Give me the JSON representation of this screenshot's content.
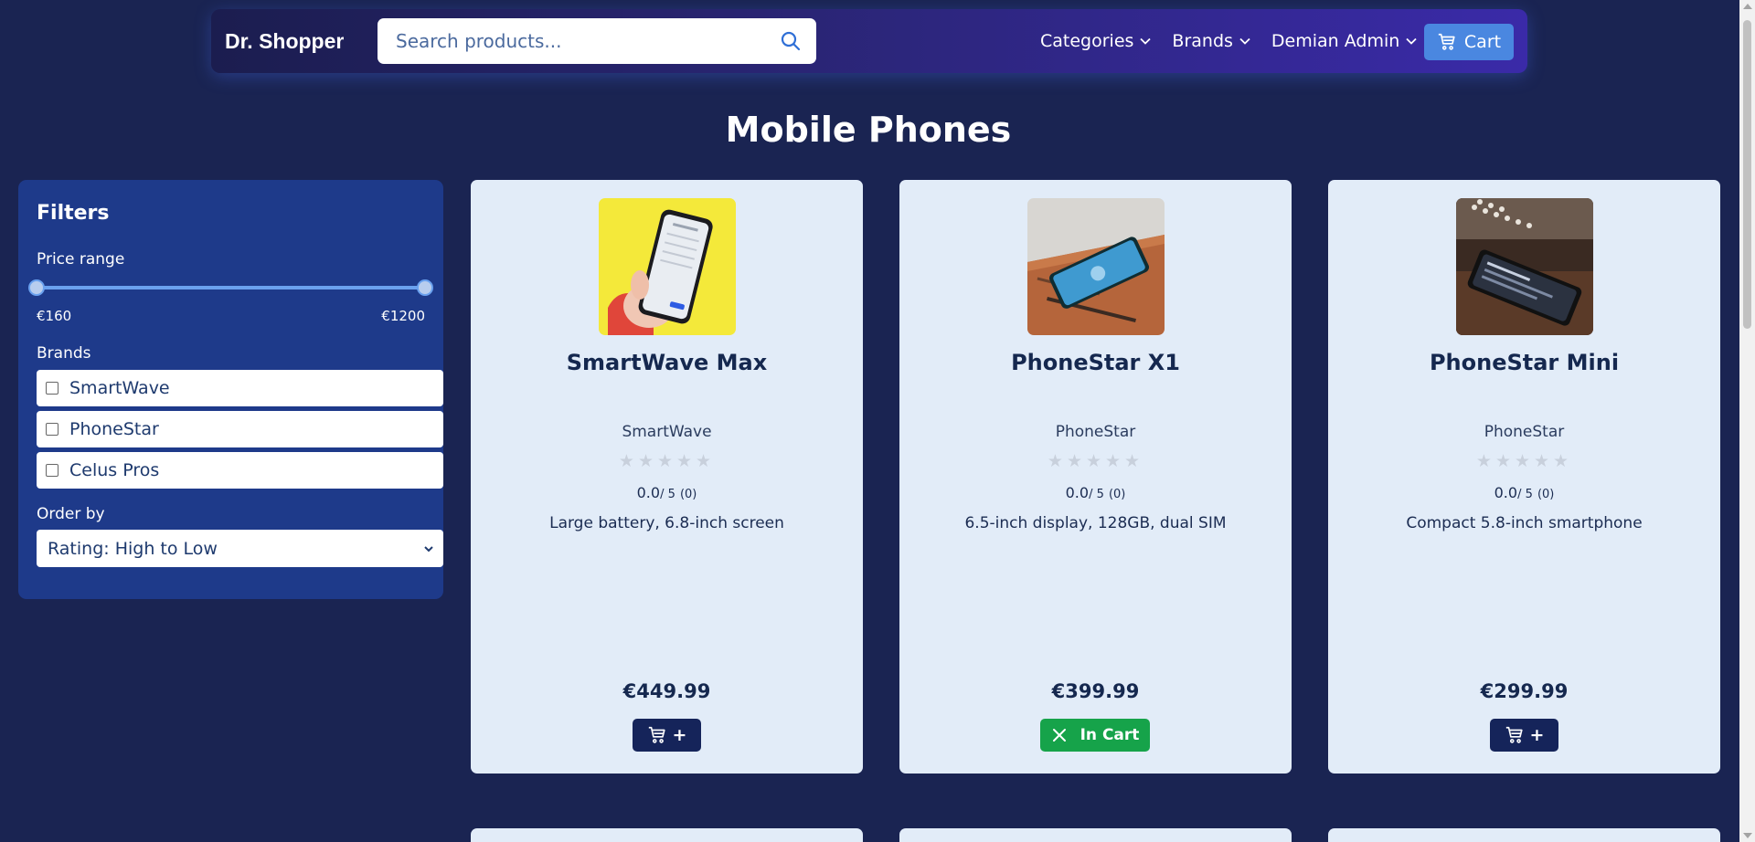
{
  "navbar": {
    "brand": "Dr. Shopper",
    "search_placeholder": "Search products...",
    "links": [
      {
        "label": "Categories"
      },
      {
        "label": "Brands"
      },
      {
        "label": "Demian Admin"
      }
    ],
    "cart_label": "Cart"
  },
  "page_title": "Mobile Phones",
  "filters": {
    "title": "Filters",
    "price_range_label": "Price range",
    "price_min": "€160",
    "price_max": "€1200",
    "price_range_fraction": [
      0.0,
      1.0
    ],
    "brands_label": "Brands",
    "brands": [
      {
        "label": "SmartWave",
        "checked": false
      },
      {
        "label": "PhoneStar",
        "checked": false
      },
      {
        "label": "Celus Pros",
        "checked": false
      }
    ],
    "order_label": "Order by",
    "order_value": "Rating: High to Low"
  },
  "products": [
    {
      "name": "SmartWave Max",
      "brand": "SmartWave",
      "stars": "★★★★★",
      "rating": "0.0",
      "rating_suffix": "/ 5",
      "rating_count": "(0)",
      "description": "Large battery, 6.8-inch screen",
      "price": "€449.99",
      "in_cart": false,
      "add_label": "+"
    },
    {
      "name": "PhoneStar X1",
      "brand": "PhoneStar",
      "stars": "★★★★★",
      "rating": "0.0",
      "rating_suffix": "/ 5",
      "rating_count": "(0)",
      "description": "6.5-inch display, 128GB, dual SIM",
      "price": "€399.99",
      "in_cart": true,
      "in_cart_label": "In Cart"
    },
    {
      "name": "PhoneStar Mini",
      "brand": "PhoneStar",
      "stars": "★★★★★",
      "rating": "0.0",
      "rating_suffix": "/ 5",
      "rating_count": "(0)",
      "description": "Compact 5.8-inch smartphone",
      "price": "€299.99",
      "in_cart": false,
      "add_label": "+"
    }
  ],
  "colors": {
    "background": "#1a2452",
    "filters_panel": "#1e3a8a",
    "card": "#e2ecf8",
    "cart_button": "#4a87e0",
    "add_button": "#15245a",
    "in_cart_button": "#16a34a"
  },
  "icons": [
    "search-icon",
    "chevron-down-icon",
    "cart-icon",
    "close-icon"
  ]
}
